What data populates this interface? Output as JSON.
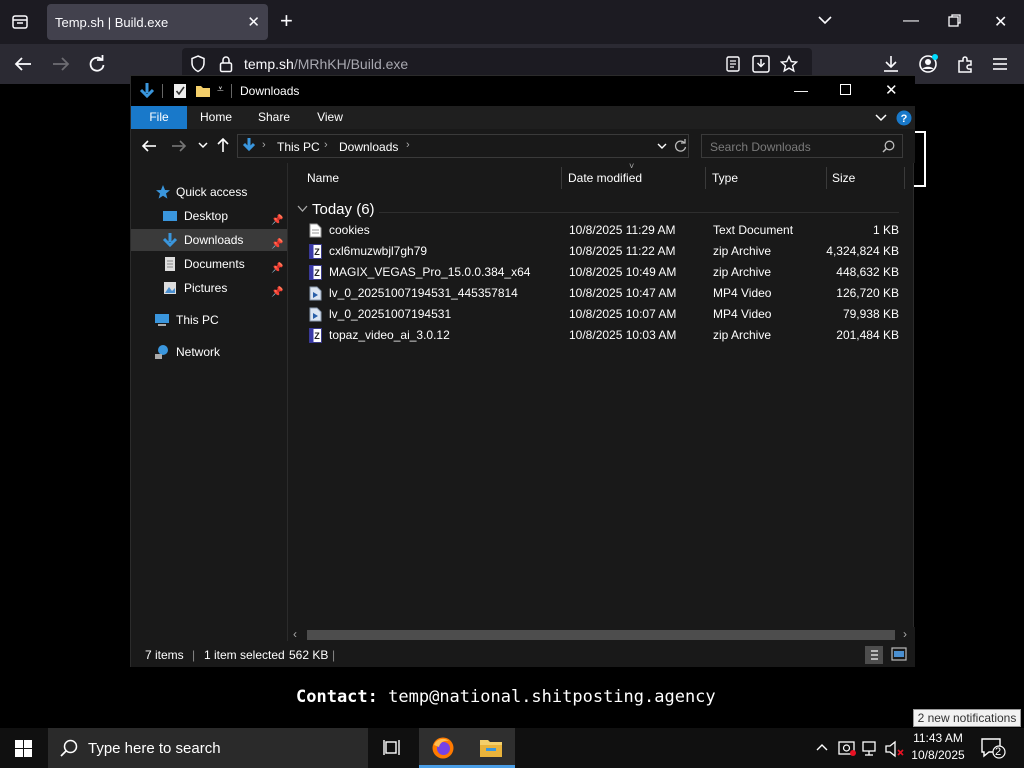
{
  "browser": {
    "tab_title": "Temp.sh | Build.exe",
    "url_host": "temp.sh",
    "url_path": "/MRhKH/Build.exe"
  },
  "page": {
    "contact_label": "Contact:",
    "contact_email": "temp@national.shitposting.agency"
  },
  "explorer": {
    "title": "Downloads",
    "ribbon_tabs": [
      "File",
      "Home",
      "Share",
      "View"
    ],
    "breadcrumb": [
      "This PC",
      "Downloads"
    ],
    "search_placeholder": "Search Downloads",
    "nav": {
      "quick_access": "Quick access",
      "desktop": "Desktop",
      "downloads": "Downloads",
      "documents": "Documents",
      "pictures": "Pictures",
      "this_pc": "This PC",
      "network": "Network"
    },
    "columns": {
      "name": "Name",
      "date": "Date modified",
      "type": "Type",
      "size": "Size"
    },
    "group_header": "Today (6)",
    "files": [
      {
        "name": "cookies",
        "date": "10/8/2025 11:29 AM",
        "type": "Text Document",
        "size": "1 KB",
        "icon": "text-file-icon"
      },
      {
        "name": "cxl6muzwbjl7gh79",
        "date": "10/8/2025 11:22 AM",
        "type": "zip Archive",
        "size": "4,324,824 KB",
        "icon": "zip-icon"
      },
      {
        "name": "MAGIX_VEGAS_Pro_15.0.0.384_x64",
        "date": "10/8/2025 10:49 AM",
        "type": "zip Archive",
        "size": "448,632 KB",
        "icon": "zip-icon"
      },
      {
        "name": "lv_0_20251007194531_445357814",
        "date": "10/8/2025 10:47 AM",
        "type": "MP4 Video",
        "size": "126,720 KB",
        "icon": "video-icon"
      },
      {
        "name": "lv_0_20251007194531",
        "date": "10/8/2025 10:07 AM",
        "type": "MP4 Video",
        "size": "79,938 KB",
        "icon": "video-icon"
      },
      {
        "name": "topaz_video_ai_3.0.12",
        "date": "10/8/2025 10:03 AM",
        "type": "zip Archive",
        "size": "201,484 KB",
        "icon": "zip-icon"
      }
    ],
    "status": {
      "items": "7 items",
      "selected": "1 item selected",
      "selected_size": "562 KB"
    }
  },
  "taskbar": {
    "search_placeholder": "Type here to search",
    "time": "11:43 AM",
    "date": "10/8/2025",
    "notification_count": "2",
    "notification_toast": "2 new notifications"
  },
  "colors": {
    "accent": "#1979ca",
    "browser_bg": "#1c1b22",
    "explorer_bg": "#191919"
  }
}
